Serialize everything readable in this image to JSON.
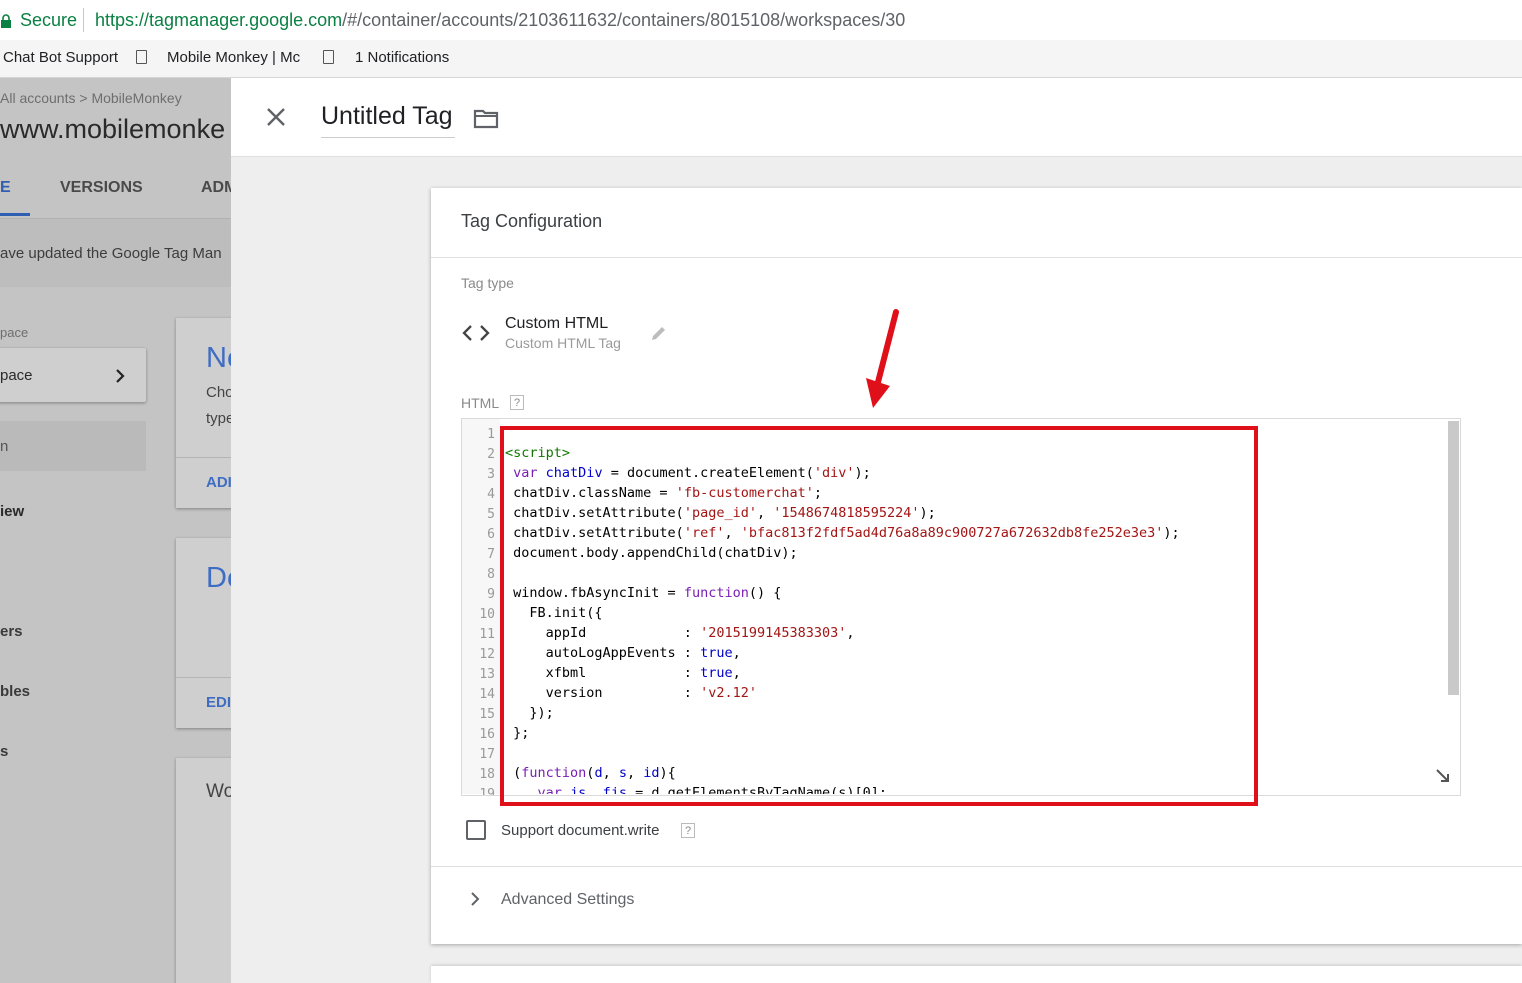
{
  "browser": {
    "secure_label": "Secure",
    "url_host": "https://tagmanager.google.com",
    "url_path": "/#/container/accounts/2103611632/containers/8015108/workspaces/30",
    "bookmarks": [
      "Chat Bot Support",
      "Mobile Monkey | Mc",
      "1 Notifications"
    ]
  },
  "background": {
    "breadcrumb": "All accounts  >  MobileMonkey",
    "container_name": "www.mobilemonke",
    "tabs": [
      "E",
      "VERSIONS",
      "ADM"
    ],
    "notice": "ave updated the Google Tag Man",
    "workspace_label": "pace",
    "workspace_item": "pace",
    "sidebar_items": [
      "iew",
      "ers",
      "bles",
      "s"
    ],
    "cards": [
      {
        "title": "Ne",
        "line1": "Cho",
        "line2": "type",
        "action": "ADI"
      },
      {
        "title": "De",
        "action": "EDI"
      },
      {
        "title": "Wo"
      }
    ]
  },
  "panel": {
    "title": "Untitled Tag",
    "config_title": "Tag Configuration",
    "tag_type_label": "Tag type",
    "tag_type_name": "Custom HTML",
    "tag_type_sub": "Custom HTML Tag",
    "html_label": "HTML",
    "help_glyph": "?",
    "support_docwrite": "Support document.write",
    "advanced_settings": "Advanced Settings",
    "code_line_numbers": [
      "1",
      "2",
      "3",
      "4",
      "5",
      "6",
      "7",
      "8",
      "9",
      "10",
      "11",
      "12",
      "13",
      "14",
      "15",
      "16",
      "17",
      "18",
      "19"
    ]
  },
  "colors": {
    "highlight": "#e0101a",
    "secure": "#0b8043",
    "link_blue": "#4285f4"
  }
}
